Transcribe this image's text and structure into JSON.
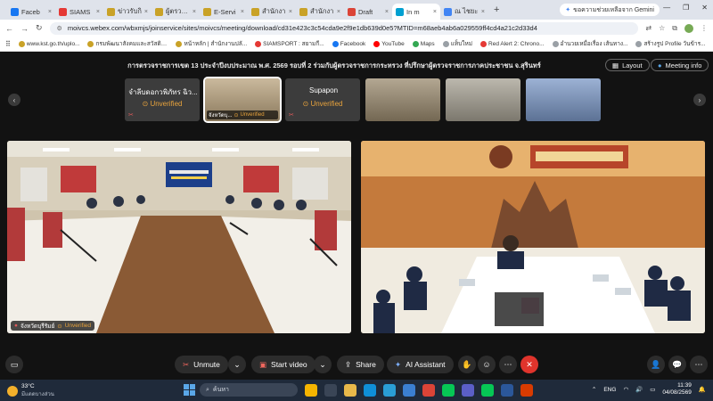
{
  "browser": {
    "tabs": [
      {
        "label": "Faceb",
        "color": "#1877f2",
        "active": false
      },
      {
        "label": "SIAMS",
        "color": "#e53935",
        "active": false
      },
      {
        "label": "ข่าวรับกิ",
        "color": "#c9a227",
        "active": false
      },
      {
        "label": "ผู้ตรวจรา",
        "color": "#c9a227",
        "active": false
      },
      {
        "label": "E-Servi",
        "color": "#c9a227",
        "active": false
      },
      {
        "label": "สำนักงา",
        "color": "#c9a227",
        "active": false
      },
      {
        "label": "สำนักงา",
        "color": "#c9a227",
        "active": false
      },
      {
        "label": "Draft",
        "color": "#db4437",
        "active": false
      },
      {
        "label": "In m",
        "color": "#00a0d1",
        "active": true
      },
      {
        "label": "ณ ไชยะ",
        "color": "#4285f4",
        "active": false
      }
    ],
    "gemini_label": "ขอความช่วยเหลือจาก Gemini",
    "url": "moivcs.webex.com/wbxmjs/joinservice/sites/moivcs/meeting/download/cd31e423c3c54cda9e2f9e1db639d0e5?MTID=m68aeb4ab6a029559ff4cd4a21c2d33d4",
    "bookmarks": [
      {
        "label": "www.kst.go.th/uplo...",
        "color": "#c9a227"
      },
      {
        "label": "กรมพัฒนาสังคมและสวัสดิการ...",
        "color": "#c9a227"
      },
      {
        "label": "หน้าหลัก | สำนักงานปลั...",
        "color": "#c9a227"
      },
      {
        "label": "SIAMSPORT : สยามกี...",
        "color": "#e53935"
      },
      {
        "label": "Facebook",
        "color": "#1877f2"
      },
      {
        "label": "YouTube",
        "color": "#ff0000"
      },
      {
        "label": "Maps",
        "color": "#34a853"
      },
      {
        "label": "แท็บใหม่",
        "color": "#9aa0a6"
      },
      {
        "label": "Red Alert 2: Chrono...",
        "color": "#e53935"
      },
      {
        "label": "อำนวยเหมื่อเรื่อง เส้นทาง...",
        "color": "#9aa0a6"
      },
      {
        "label": "สร้างรูป Profile วันข้าร...",
        "color": "#9aa0a6"
      }
    ]
  },
  "meeting": {
    "title": "การตรวจราชการเขต 13 ประจำปีงบประมาณ พ.ศ. 2569 รอบที่ 2 ร่วมกับผู้ตรวจราชการกระทรวง ที่ปรึกษาผู้ตรวจราชการภาคประชาชน จ.สุรินทร์",
    "layout_label": "Layout",
    "info_label": "Meeting info",
    "thumbnails": [
      {
        "kind": "text",
        "name": "จำลีบดอกวพิภัทร ฉิว...",
        "status": "Unverified"
      },
      {
        "kind": "video",
        "name": "จังหวัดบุ...",
        "status": "Unverified",
        "color": "#b9a27c"
      },
      {
        "kind": "text",
        "name": "Supapon",
        "status": "Unverified"
      },
      {
        "kind": "video",
        "color": "#9a8a6e"
      },
      {
        "kind": "video",
        "color": "#a5a092"
      },
      {
        "kind": "video",
        "color": "#7b98c6"
      }
    ],
    "tiles": [
      {
        "name": "จังหวัดบุรีรัมย์",
        "status": "Unverified"
      },
      {
        "name": "",
        "status": ""
      }
    ]
  },
  "controls": {
    "mute": "Unmute",
    "video": "Start video",
    "share": "Share",
    "ai": "AI Assistant"
  },
  "taskbar": {
    "temp": "33°C",
    "weather_desc": "มีแดดบางส่วน",
    "search": "ค้นหา",
    "lang": "ENG",
    "time": "11:39",
    "date": "04/08/2569"
  }
}
